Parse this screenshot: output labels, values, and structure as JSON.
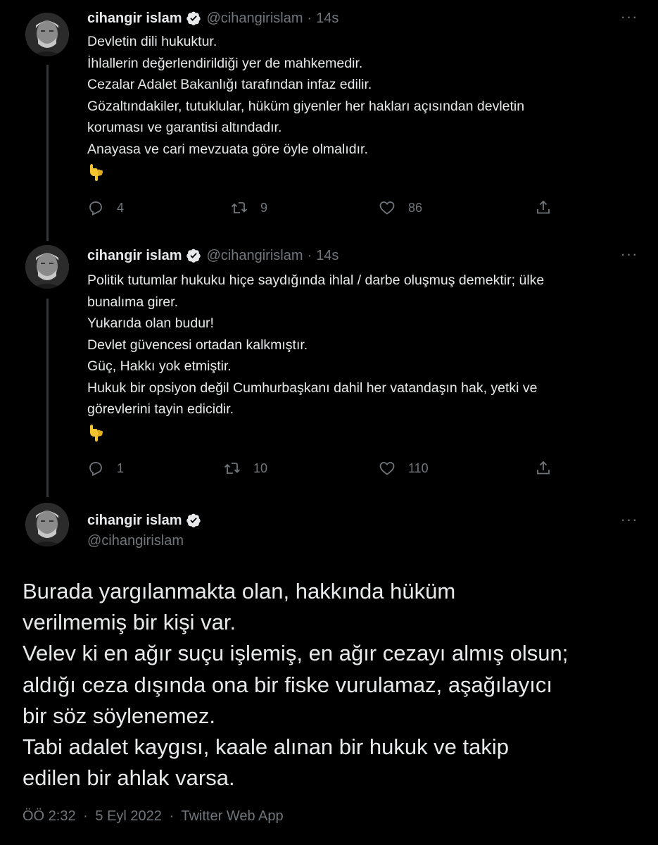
{
  "tweets": [
    {
      "author_name": "cihangir islam",
      "author_handle": "@cihangirislam",
      "separator": "·",
      "time": "14s",
      "more": "···",
      "lines": [
        "Devletin dili hukuktur.",
        "İhlallerin değerlendirildiği yer de mahkemedir.",
        "Cezalar Adalet Bakanlığı tarafından infaz edilir.",
        "Gözaltındakiler, tutuklular, hüküm giyenler her hakları açısından devletin",
        "koruması ve garantisi altındadır.",
        "Anayasa ve cari mevzuata göre öyle olmalıdır."
      ],
      "emoji": "backhand-index-pointing-down",
      "replies": "4",
      "retweets": "9",
      "likes": "86"
    },
    {
      "author_name": "cihangir islam",
      "author_handle": "@cihangirislam",
      "separator": "·",
      "time": "14s",
      "more": "···",
      "lines": [
        "Politik tutumlar hukuku hiçe saydığında ihlal / darbe oluşmuş demektir; ülke",
        "bunalıma girer.",
        "Yukarıda olan budur!",
        "Devlet güvencesi ortadan kalkmıştır.",
        "Güç, Hakkı yok etmiştir.",
        "Hukuk bir opsiyon değil Cumhurbaşkanı dahil her vatandaşın hak, yetki ve",
        "görevlerini tayin edicidir."
      ],
      "emoji": "backhand-index-pointing-down",
      "replies": "1",
      "retweets": "10",
      "likes": "110"
    }
  ],
  "main_tweet": {
    "author_name": "cihangir islam",
    "author_handle": "@cihangirislam",
    "more": "···",
    "lines": [
      "Burada yargılanmakta olan, hakkında hüküm",
      "verilmemiş bir kişi var.",
      "Velev ki en ağır suçu işlemiş, en ağır cezayı almış olsun;",
      "aldığı ceza dışında ona bir fiske vurulamaz, aşağılayıcı",
      "bir söz söylenemez.",
      "Tabi adalet kaygısı, kaale alınan bir hukuk ve takip",
      "edilen bir ahlak varsa."
    ],
    "time": "ÖÖ 2:32",
    "separator": "·",
    "date": "5 Eyl 2022",
    "source": "Twitter Web App"
  },
  "colors": {
    "background": "#000000",
    "text": "#e7e9ea",
    "secondary": "#71767b",
    "thread_line": "#333639",
    "verified_badge": "#e7e9ea"
  },
  "icons": {
    "reply": "reply-icon",
    "retweet": "retweet-icon",
    "like": "like-icon",
    "share": "share-icon",
    "verified": "verified-badge-icon",
    "more": "more-icon"
  }
}
